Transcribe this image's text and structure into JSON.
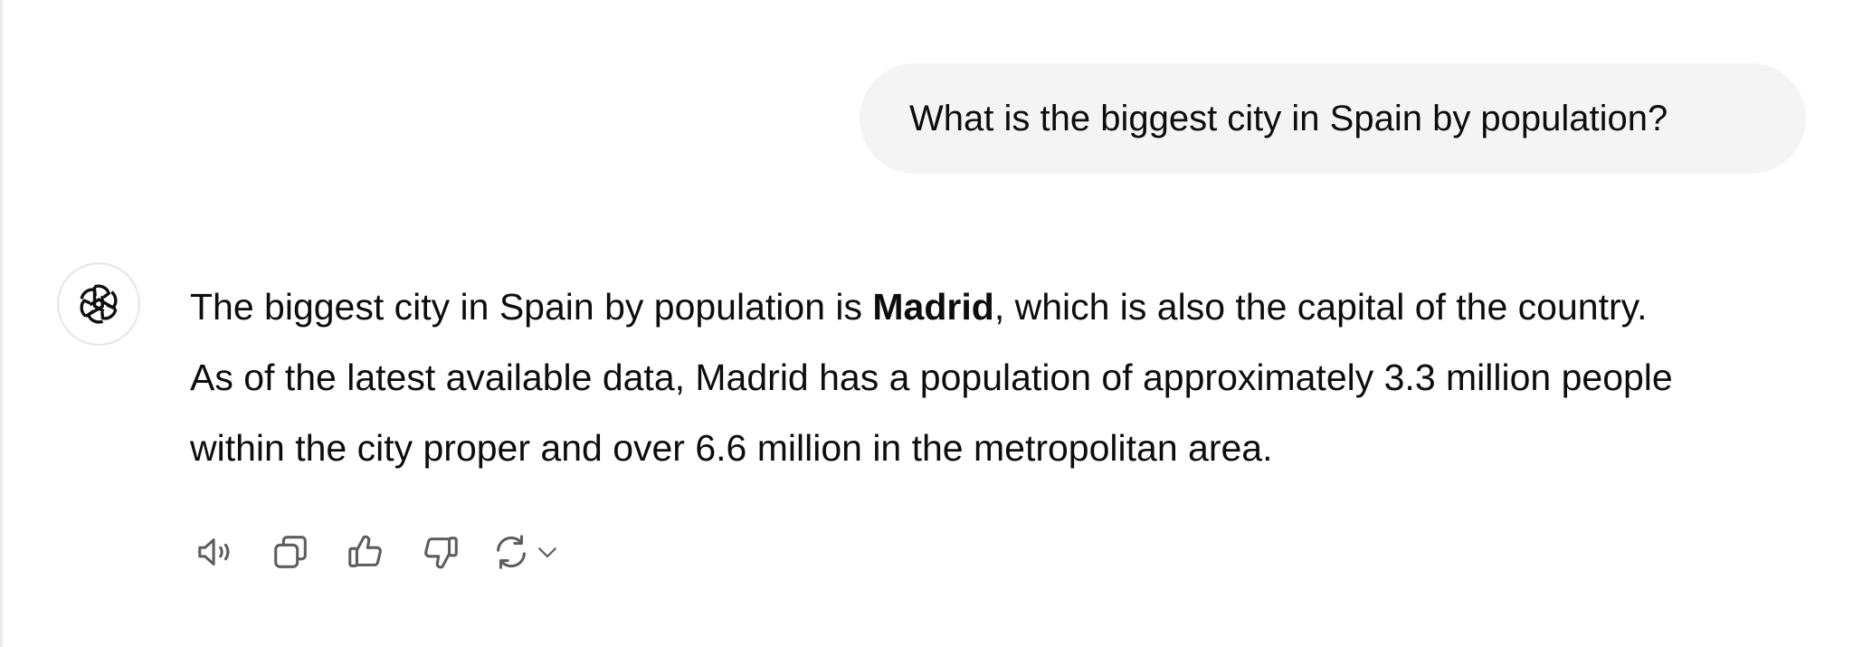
{
  "user_message": {
    "text": "What is the biggest city in Spain by population?"
  },
  "assistant_message": {
    "avatar_icon": "openai-logo-icon",
    "line1_before": "The biggest city in Spain by population is ",
    "line1_bold": "Madrid",
    "line1_after": ", which is also the capital of the country.",
    "line2": "As of the latest available data, Madrid has a population of approximately 3.3 million people",
    "line3": "within the city proper and over 6.6 million in the metropolitan area."
  },
  "actions": [
    {
      "name": "read-aloud",
      "icon": "speaker-icon"
    },
    {
      "name": "copy",
      "icon": "copy-icon"
    },
    {
      "name": "good-response",
      "icon": "thumbs-up-icon"
    },
    {
      "name": "bad-response",
      "icon": "thumbs-down-icon"
    },
    {
      "name": "regenerate",
      "icon": "refresh-icon"
    }
  ],
  "colors": {
    "bubble_bg": "#f4f4f4",
    "text": "#0d0d0d",
    "icon": "#5d5d5d"
  }
}
